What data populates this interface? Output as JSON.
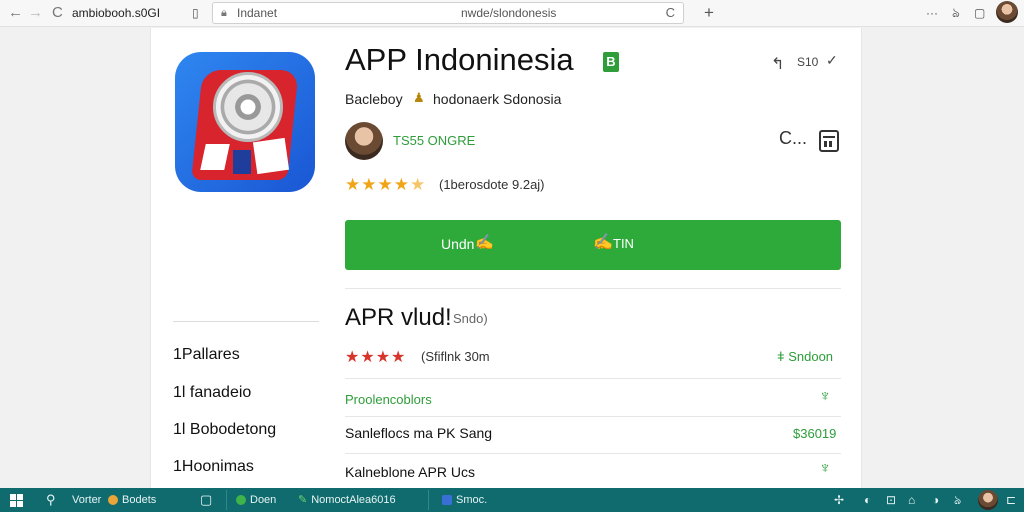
{
  "browser": {
    "back_icon": "←",
    "forward_icon": "→",
    "reload_icon": "C",
    "tab_title": "ambiobooh.s0GI",
    "bookmark_icon": "▯",
    "site_label": "Indanet",
    "url": "nwde/slondonesis",
    "refresh_icon": "C",
    "new_tab_icon": "+",
    "menu_icon": "···",
    "ext1_icon": "ঌ",
    "ext2_icon": "▢"
  },
  "app": {
    "title": "APP Indoninesia",
    "badge": "B",
    "share_icon": "↰",
    "share_label": "S10",
    "chevron_icon": "✓",
    "developer_label": "Bacleboy",
    "developer_icon": "♟",
    "developer_name": "hodonaerk Sdonosia",
    "dev_link": "TS55 ONGRE",
    "phone_icon": "C...",
    "stars": "★★★★",
    "half_star": "★",
    "reviews": "(1berosdote 9.2aj)",
    "install_label": "Undn",
    "install_icon": "✍",
    "install_icon2": "✍",
    "install_label2": "TIN"
  },
  "sidebar": {
    "items": [
      "1Pallares",
      "1l fanadeio",
      "1l Bobodetong",
      "1Hoonimas"
    ]
  },
  "section": {
    "title": "APR vlud!",
    "subtitle": "Sndo)",
    "stars": "★★★★",
    "rating_meta": "(Sfiflnk 30m",
    "link": "ǂ Sndoon",
    "row1": "Proolencoblors",
    "row1_icon": "♆",
    "row2": "Sanleflocs ma PK Sang",
    "row2_price": "$36019",
    "row3": "Kalneblone APR Ucs",
    "row3_icon": "♆"
  },
  "taskbar": {
    "search_icon": "⚲",
    "search_label": "Vorter",
    "app1": "Bodets",
    "window_icon": "▢",
    "app2": "Doen",
    "app3_icon": "✎",
    "app3": "NomoctAlea6016",
    "app4": "Smoc.",
    "tray": [
      "✢",
      "◐",
      "⊡",
      "⌂"
    ],
    "tray_clock": "◑",
    "tray_sound": "ঌ",
    "tray_end": "⊏"
  },
  "colors": {
    "accent_green": "#2eaa3a",
    "taskbar": "#0f6b6d",
    "star": "#f0a519",
    "star_red": "#d9342c"
  }
}
